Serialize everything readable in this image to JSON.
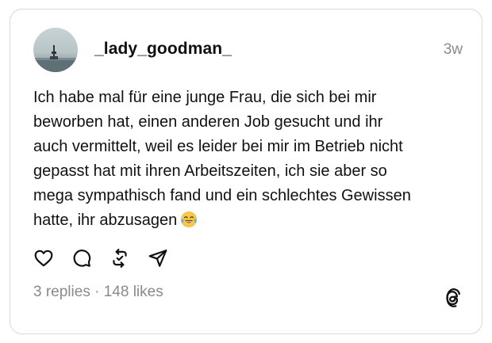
{
  "post": {
    "username": "_lady_goodman_",
    "timestamp": "3w",
    "text": "Ich habe mal für eine junge Frau, die sich bei mir\nbeworben hat, einen anderen Job gesucht und ihr\nauch vermittelt, weil es leider bei mir im Betrieb nicht\ngepasst hat mit ihren Arbeitszeiten, ich sie aber so\nmega sympathisch fand und ein schlechtes Gewissen\nhatte, ihr abzusagen",
    "emoji": "tears-of-joy-emoji",
    "replies": "3 replies",
    "separator": "·",
    "likes": "148 likes"
  },
  "actions": [
    {
      "icon": "heart-icon"
    },
    {
      "icon": "comment-icon"
    },
    {
      "icon": "repost-icon"
    },
    {
      "icon": "share-icon"
    }
  ],
  "branding": {
    "icon": "threads-logo-icon"
  },
  "colors": {
    "text": "#101010",
    "secondary": "#8a8a8a",
    "border": "#d9d9d9",
    "emoji": "#f7c948"
  }
}
